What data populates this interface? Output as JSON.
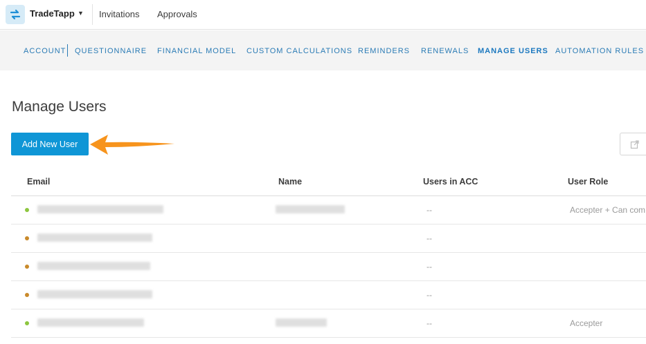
{
  "topbar": {
    "app_name": "TradeTapp",
    "links": [
      "Invitations",
      "Approvals"
    ]
  },
  "subnav": {
    "items": [
      "ACCOUNT",
      "QUESTIONNAIRE",
      "FINANCIAL MODEL",
      "CUSTOM CALCULATIONS",
      "REMINDERS",
      "RENEWALS",
      "MANAGE USERS",
      "AUTOMATION RULES"
    ],
    "active": "MANAGE USERS"
  },
  "main": {
    "title": "Manage Users",
    "add_button_label": "Add New User"
  },
  "table": {
    "headers": [
      "Email",
      "Name",
      "Users in ACC",
      "User Role"
    ],
    "rows": [
      {
        "status": "active",
        "acc": "--",
        "role": "Accepter + Can com"
      },
      {
        "status": "pending",
        "acc": "--",
        "role": ""
      },
      {
        "status": "pending",
        "acc": "--",
        "role": ""
      },
      {
        "status": "pending",
        "acc": "--",
        "role": ""
      },
      {
        "status": "active",
        "acc": "--",
        "role": "Accepter"
      }
    ]
  },
  "colors": {
    "accent": "#0f96d6",
    "nav_link": "#2a7bb5",
    "status_active": "#8dc63f",
    "status_pending": "#c98a2b",
    "arrow": "#f7941d"
  },
  "icons": {
    "logo": "tradetapp-logo-icon",
    "caret": "caret-down-icon",
    "export": "export-icon",
    "arrow": "annotation-arrow-icon"
  }
}
